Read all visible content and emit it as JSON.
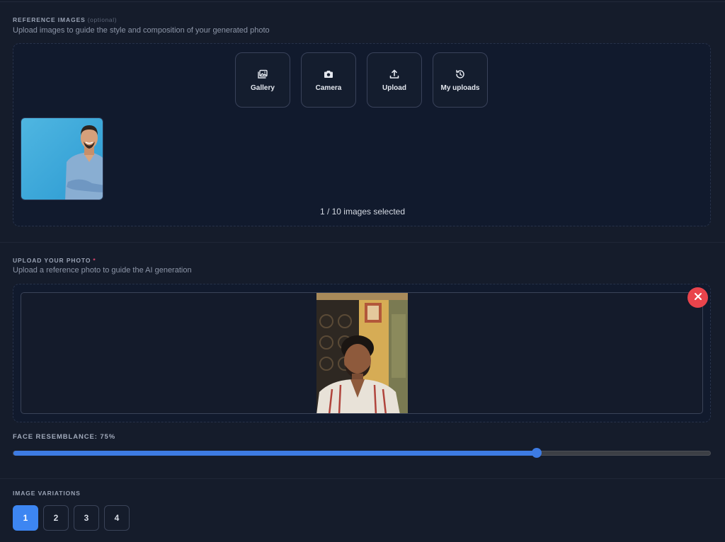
{
  "reference_images": {
    "title": "REFERENCE IMAGES",
    "optional_tag": "(optional)",
    "subtitle": "Upload images to guide the style and composition of your generated photo",
    "sources": [
      {
        "label": "Gallery",
        "icon": "gallery-icon"
      },
      {
        "label": "Camera",
        "icon": "camera-icon"
      },
      {
        "label": "Upload",
        "icon": "upload-icon"
      },
      {
        "label": "My uploads",
        "icon": "history-icon"
      }
    ],
    "selected_count_text": "1 / 10 images selected"
  },
  "upload_photo": {
    "title": "UPLOAD YOUR PHOTO",
    "required_mark": "*",
    "subtitle": "Upload a reference photo to guide the AI generation",
    "remove_icon": "close-icon"
  },
  "face_resemblance": {
    "label": "FACE RESEMBLANCE: 75%",
    "value": 75
  },
  "image_variations": {
    "title": "IMAGE VARIATIONS",
    "options": [
      "1",
      "2",
      "3",
      "4"
    ],
    "selected": "1"
  },
  "colors": {
    "background": "#151c2b",
    "panel": "#111a2d",
    "accent": "#3d86f2",
    "danger": "#e9444c"
  }
}
